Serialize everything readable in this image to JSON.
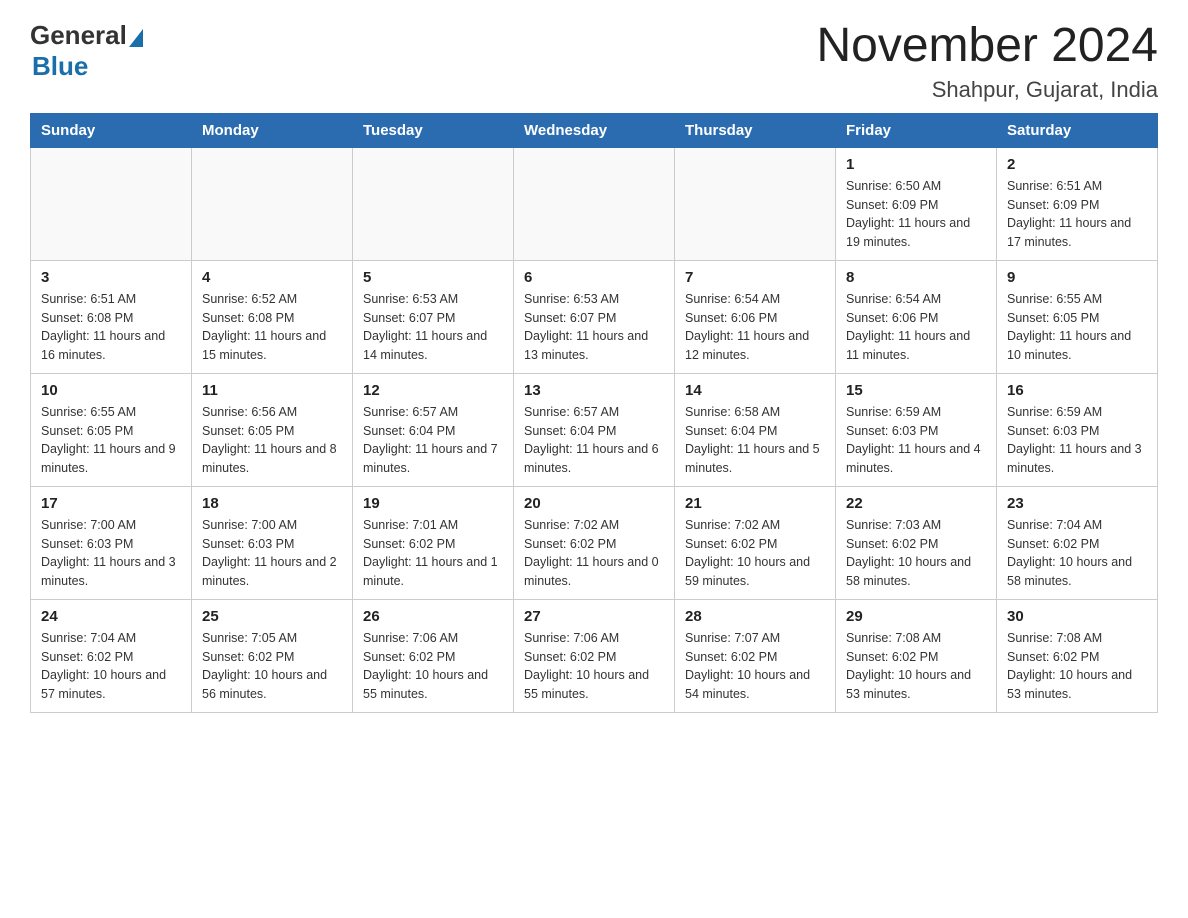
{
  "header": {
    "logo_general": "General",
    "logo_blue": "Blue",
    "title": "November 2024",
    "location": "Shahpur, Gujarat, India"
  },
  "days_of_week": [
    "Sunday",
    "Monday",
    "Tuesday",
    "Wednesday",
    "Thursday",
    "Friday",
    "Saturday"
  ],
  "weeks": [
    [
      {
        "day": "",
        "info": ""
      },
      {
        "day": "",
        "info": ""
      },
      {
        "day": "",
        "info": ""
      },
      {
        "day": "",
        "info": ""
      },
      {
        "day": "",
        "info": ""
      },
      {
        "day": "1",
        "info": "Sunrise: 6:50 AM\nSunset: 6:09 PM\nDaylight: 11 hours and 19 minutes."
      },
      {
        "day": "2",
        "info": "Sunrise: 6:51 AM\nSunset: 6:09 PM\nDaylight: 11 hours and 17 minutes."
      }
    ],
    [
      {
        "day": "3",
        "info": "Sunrise: 6:51 AM\nSunset: 6:08 PM\nDaylight: 11 hours and 16 minutes."
      },
      {
        "day": "4",
        "info": "Sunrise: 6:52 AM\nSunset: 6:08 PM\nDaylight: 11 hours and 15 minutes."
      },
      {
        "day": "5",
        "info": "Sunrise: 6:53 AM\nSunset: 6:07 PM\nDaylight: 11 hours and 14 minutes."
      },
      {
        "day": "6",
        "info": "Sunrise: 6:53 AM\nSunset: 6:07 PM\nDaylight: 11 hours and 13 minutes."
      },
      {
        "day": "7",
        "info": "Sunrise: 6:54 AM\nSunset: 6:06 PM\nDaylight: 11 hours and 12 minutes."
      },
      {
        "day": "8",
        "info": "Sunrise: 6:54 AM\nSunset: 6:06 PM\nDaylight: 11 hours and 11 minutes."
      },
      {
        "day": "9",
        "info": "Sunrise: 6:55 AM\nSunset: 6:05 PM\nDaylight: 11 hours and 10 minutes."
      }
    ],
    [
      {
        "day": "10",
        "info": "Sunrise: 6:55 AM\nSunset: 6:05 PM\nDaylight: 11 hours and 9 minutes."
      },
      {
        "day": "11",
        "info": "Sunrise: 6:56 AM\nSunset: 6:05 PM\nDaylight: 11 hours and 8 minutes."
      },
      {
        "day": "12",
        "info": "Sunrise: 6:57 AM\nSunset: 6:04 PM\nDaylight: 11 hours and 7 minutes."
      },
      {
        "day": "13",
        "info": "Sunrise: 6:57 AM\nSunset: 6:04 PM\nDaylight: 11 hours and 6 minutes."
      },
      {
        "day": "14",
        "info": "Sunrise: 6:58 AM\nSunset: 6:04 PM\nDaylight: 11 hours and 5 minutes."
      },
      {
        "day": "15",
        "info": "Sunrise: 6:59 AM\nSunset: 6:03 PM\nDaylight: 11 hours and 4 minutes."
      },
      {
        "day": "16",
        "info": "Sunrise: 6:59 AM\nSunset: 6:03 PM\nDaylight: 11 hours and 3 minutes."
      }
    ],
    [
      {
        "day": "17",
        "info": "Sunrise: 7:00 AM\nSunset: 6:03 PM\nDaylight: 11 hours and 3 minutes."
      },
      {
        "day": "18",
        "info": "Sunrise: 7:00 AM\nSunset: 6:03 PM\nDaylight: 11 hours and 2 minutes."
      },
      {
        "day": "19",
        "info": "Sunrise: 7:01 AM\nSunset: 6:02 PM\nDaylight: 11 hours and 1 minute."
      },
      {
        "day": "20",
        "info": "Sunrise: 7:02 AM\nSunset: 6:02 PM\nDaylight: 11 hours and 0 minutes."
      },
      {
        "day": "21",
        "info": "Sunrise: 7:02 AM\nSunset: 6:02 PM\nDaylight: 10 hours and 59 minutes."
      },
      {
        "day": "22",
        "info": "Sunrise: 7:03 AM\nSunset: 6:02 PM\nDaylight: 10 hours and 58 minutes."
      },
      {
        "day": "23",
        "info": "Sunrise: 7:04 AM\nSunset: 6:02 PM\nDaylight: 10 hours and 58 minutes."
      }
    ],
    [
      {
        "day": "24",
        "info": "Sunrise: 7:04 AM\nSunset: 6:02 PM\nDaylight: 10 hours and 57 minutes."
      },
      {
        "day": "25",
        "info": "Sunrise: 7:05 AM\nSunset: 6:02 PM\nDaylight: 10 hours and 56 minutes."
      },
      {
        "day": "26",
        "info": "Sunrise: 7:06 AM\nSunset: 6:02 PM\nDaylight: 10 hours and 55 minutes."
      },
      {
        "day": "27",
        "info": "Sunrise: 7:06 AM\nSunset: 6:02 PM\nDaylight: 10 hours and 55 minutes."
      },
      {
        "day": "28",
        "info": "Sunrise: 7:07 AM\nSunset: 6:02 PM\nDaylight: 10 hours and 54 minutes."
      },
      {
        "day": "29",
        "info": "Sunrise: 7:08 AM\nSunset: 6:02 PM\nDaylight: 10 hours and 53 minutes."
      },
      {
        "day": "30",
        "info": "Sunrise: 7:08 AM\nSunset: 6:02 PM\nDaylight: 10 hours and 53 minutes."
      }
    ]
  ]
}
